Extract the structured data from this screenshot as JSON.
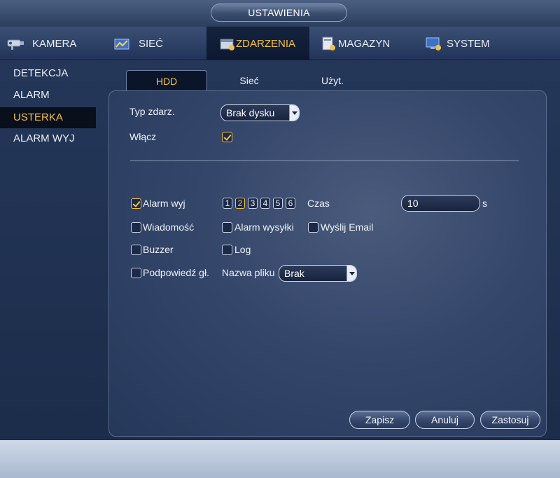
{
  "window": {
    "title": "USTAWIENIA"
  },
  "topnav": {
    "items": [
      {
        "label": "KAMERA",
        "icon": "camera-icon",
        "active": false
      },
      {
        "label": "SIEĆ",
        "icon": "network-icon",
        "active": false
      },
      {
        "label": "ZDARZENIA",
        "icon": "events-icon",
        "active": true
      },
      {
        "label": "MAGAZYN",
        "icon": "storage-icon",
        "active": false
      },
      {
        "label": "SYSTEM",
        "icon": "system-icon",
        "active": false
      }
    ]
  },
  "sidebar": {
    "items": [
      {
        "label": "DETEKCJA",
        "active": false
      },
      {
        "label": "ALARM",
        "active": false
      },
      {
        "label": "USTERKA",
        "active": true
      },
      {
        "label": "ALARM WYJ",
        "active": false
      }
    ]
  },
  "subtabs": {
    "items": [
      {
        "label": "HDD",
        "active": true
      },
      {
        "label": "Sieć",
        "active": false
      },
      {
        "label": "Użyt.",
        "active": false
      }
    ]
  },
  "form": {
    "event_type_label": "Typ zdarz.",
    "event_type_value": "Brak dysku",
    "enable_label": "Włącz",
    "enable_checked": true,
    "alarm_out_label": "Alarm wyj",
    "alarm_out_checked": true,
    "alarm_channels": [
      "1",
      "2",
      "3",
      "4",
      "5",
      "6"
    ],
    "alarm_channel_selected": "2",
    "time_label": "Czas",
    "time_value": "10",
    "time_unit": "s",
    "message_label": "Wiadomość",
    "message_checked": false,
    "alarm_upload_label": "Alarm wysyłki",
    "alarm_upload_checked": false,
    "send_email_label": "Wyślij Email",
    "send_email_checked": false,
    "buzzer_label": "Buzzer",
    "buzzer_checked": false,
    "log_label": "Log",
    "log_checked": false,
    "voice_prompt_label": "Podpowiedź gł.",
    "voice_prompt_checked": false,
    "filename_label": "Nazwa pliku",
    "filename_value": "Brak"
  },
  "buttons": {
    "save": "Zapisz",
    "cancel": "Anuluj",
    "apply": "Zastosuj"
  },
  "colors": {
    "accent": "#f4c242",
    "background": "#26395b",
    "panel": "#34466a"
  }
}
